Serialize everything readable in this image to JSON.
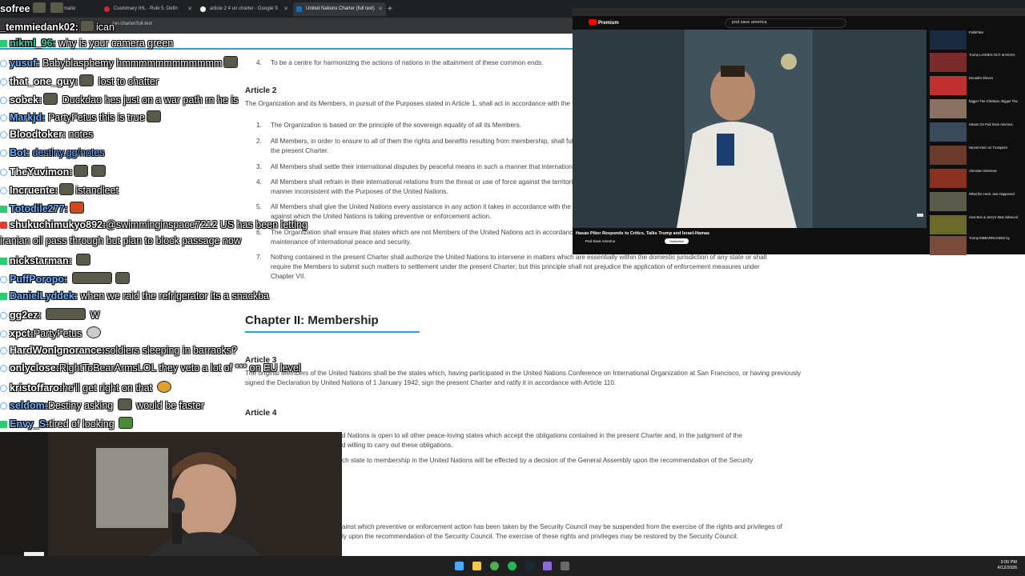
{
  "browser": {
    "tabs": [
      {
        "label": "ernatio"
      },
      {
        "label": "Customary IHL - Rule 5. Defin"
      },
      {
        "label": "article 2 4 un charter - Google S"
      },
      {
        "label": "United Nations Charter (full text)"
      }
    ],
    "new_tab_label": "+",
    "url": "/un-charter/full-text"
  },
  "doc": {
    "article1_item4": "To be a centre for harmonizing the actions of nations in the attainment of these common ends.",
    "article2_heading": "Article 2",
    "article2_intro": "The Organization and its Members, in pursuit of the Purposes stated in Article 1, shall act in accordance with the following",
    "article2_items": [
      {
        "num": "1.",
        "text": "The Organization is based on the principle of the sovereign equality of all its Members."
      },
      {
        "num": "2.",
        "text": "All Members, in order to ensure to all of them the rights and benefits resulting from membership, shall fulfi",
        "text2": "the present Charter."
      },
      {
        "num": "3.",
        "text": "All Members shall settle their international disputes by peaceful means in such a manner that internationa"
      },
      {
        "num": "4.",
        "text": "All Members shall refrain in their international relations from the threat or use of force against the territori",
        "text2": "manner inconsistent with the Purposes of the United Nations."
      },
      {
        "num": "5.",
        "text": "All Members shall give the United Nations every assistance in any action it takes in accordance with the pr",
        "text2": "against which the United Nations is taking preventive or enforcement action."
      },
      {
        "num": "6.",
        "text": "The Organization shall ensure that states which are not Members of the United Nations act in accordance",
        "text2": "maintenance of international peace and security."
      },
      {
        "num": "7.",
        "text": "Nothing contained in the present Charter shall authorize the United Nations to intervene in matters which are essentially within the domestic jurisdiction of any state or shall",
        "text2": "require the Members to submit such matters to settlement under the present Charter; but this principle shall not prejudice the application of enforcement measures under",
        "text3": "Chapter VII."
      }
    ],
    "chapter2_title": "Chapter II: Membership",
    "article3_heading": "Article 3",
    "article3_text": "The original Members of the United Nations shall be the states which, having participated in the United Nations Conference on International Organization at San Francisco, or having previously",
    "article3_text2": "signed the Declaration by United Nations of 1 January 1942, sign the present Charter and ratify it in accordance with Article 110.",
    "article4_heading": "Article 4",
    "article4_text": "d Nations is open to all other peace-loving states which accept the obligations contained in the present Charter and, in the judgment of the",
    "article4_text2": "d willing to carry out these obligations.",
    "article4_text3": "ch state to membership in the United Nations will be effected by a decision of the General Assembly upon the recommendation of the Security",
    "article5_text": "ainst which preventive or enforcement action has been taken by the Security Council may be suspended from the exercise of the rights and privileges of",
    "article5_text2": "ly upon the recommendation of the Security Council. The exercise of these rights and privileges may be restored by the Security Council."
  },
  "chat": [
    {
      "user": "sofree",
      "text": "",
      "color": "#ffffff"
    },
    {
      "user": "_temmiedank02:",
      "text": "ican",
      "color": "#ffffff"
    },
    {
      "user": "nikml_96:",
      "text": "why is your camera green",
      "color": "#36d6a8"
    },
    {
      "user": "yusuf:",
      "text": "Babyblasphemy hmmmmmmmmmmmm",
      "color": "#6ab0ff"
    },
    {
      "user": "that_one_guy:",
      "text": "lost to chatter",
      "color": "#ffffff"
    },
    {
      "user": "sobek:",
      "text": "Duckdao hes just on a war path rn he is",
      "color": "#ffffff"
    },
    {
      "user": "Markjd:",
      "text": "PartyFetus this is true",
      "color": "#6ab0ff"
    },
    {
      "user": "Bloodtoker:",
      "text": "notes",
      "color": "#ffffff"
    },
    {
      "user": "Bot:",
      "text": "destiny.gg/notes",
      "color": "#6ab0ff"
    },
    {
      "user": "TheYuvimon:",
      "text": "",
      "color": "#ffffff"
    },
    {
      "user": "Incruente:",
      "text": "istandleet",
      "color": "#ffffff"
    },
    {
      "user": "Totodile277:",
      "text": "",
      "color": "#6ab0ff"
    },
    {
      "user": "shukuchimukyo892:",
      "text": "@swimminginspace7212 US has been letting",
      "color": "#ffffff"
    },
    {
      "user": "",
      "text": "iranian oil pass through but plan to block passage now",
      "color": "#ffffff"
    },
    {
      "user": "nickstarman:",
      "text": "",
      "color": "#ffffff"
    },
    {
      "user": "PuffPoropo:",
      "text": "",
      "color": "#6ab0ff"
    },
    {
      "user": "DanielLyddek:",
      "text": "when we raid the refrigerator its a snackba",
      "color": "#6ab0ff"
    },
    {
      "user": "gg2ez:",
      "text": "W",
      "color": "#ffffff"
    },
    {
      "user": "xpct:",
      "text": "PartyFetus",
      "color": "#ffffff"
    },
    {
      "user": "HardWonIgnorance:",
      "text": "soldiers sleeping in barracks?",
      "color": "#ffffff"
    },
    {
      "user": "onlyclose:",
      "text": "RightToBearArmsLOL they veto a lot of *** on EU level",
      "color": "#ffffff"
    },
    {
      "user": "kristoffaro:",
      "text": "he'll get right on that",
      "color": "#ffffff"
    },
    {
      "user": "seldom:",
      "text": "Destiny asking",
      "text2": "would be faster",
      "color": "#6ab0ff"
    },
    {
      "user": "Envy_S:",
      "text": "tired of looking",
      "color": "#6ab0ff"
    }
  ],
  "youtube": {
    "brand": "Premium",
    "search_query": "pod save america",
    "video_title": "Hasan Piker Responds to Critics, Talks Trump and Israel-Hamas",
    "channel": "Pod Save America",
    "subscribe_label": "Subscribe",
    "side_titles": [
      "PolitiFiles",
      "Trump LASHES OUT at MAGA",
      "Donald's Eleven",
      "Bigger The Christian, Bigger The",
      "Hasan On Pod Save America",
      "Naomi Klein on Trumpism",
      "Ahmetan Interview",
      "What the Heck Just Happened",
      "How Ben & Jerry's Was Silenced",
      "Trump EMBARRASSED by"
    ]
  },
  "taskbar": {
    "time": "3:00 PM",
    "date": "4/12/2026"
  }
}
